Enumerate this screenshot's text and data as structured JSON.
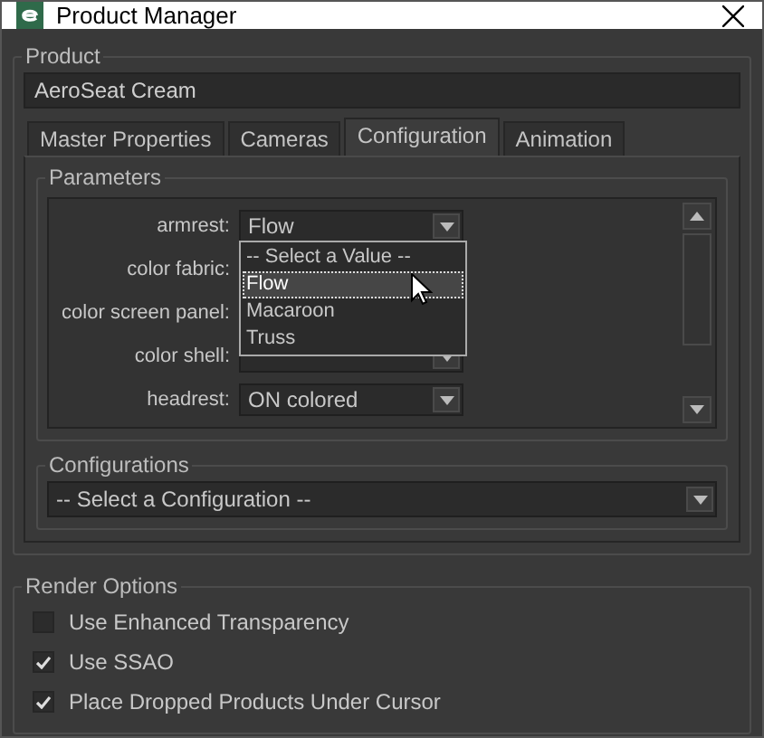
{
  "window": {
    "title": "Product Manager"
  },
  "product": {
    "legend": "Product",
    "name": "AeroSeat Cream"
  },
  "tabs": [
    {
      "label": "Master Properties",
      "selected": false
    },
    {
      "label": "Cameras",
      "selected": false
    },
    {
      "label": "Configuration",
      "selected": true
    },
    {
      "label": "Animation",
      "selected": false
    }
  ],
  "parameters": {
    "legend": "Parameters",
    "rows": [
      {
        "label": "armrest:",
        "value": "Flow"
      },
      {
        "label": "color fabric:"
      },
      {
        "label": "color screen panel:"
      },
      {
        "label": "color shell:",
        "kind": "dropdown"
      },
      {
        "label": "headrest:",
        "value": "ON colored"
      }
    ]
  },
  "dropdown": {
    "options": [
      {
        "label": "-- Select a Value --",
        "selected": false
      },
      {
        "label": "Flow",
        "selected": true
      },
      {
        "label": "Macaroon",
        "selected": false
      },
      {
        "label": "Truss",
        "selected": false
      }
    ]
  },
  "configurations": {
    "legend": "Configurations",
    "value": "-- Select a Configuration --"
  },
  "render_options": {
    "legend": "Render Options",
    "options": [
      {
        "label": "Use Enhanced Transparency",
        "checked": false
      },
      {
        "label": "Use SSAO",
        "checked": true
      },
      {
        "label": "Place Dropped Products Under Cursor",
        "checked": true
      }
    ]
  }
}
